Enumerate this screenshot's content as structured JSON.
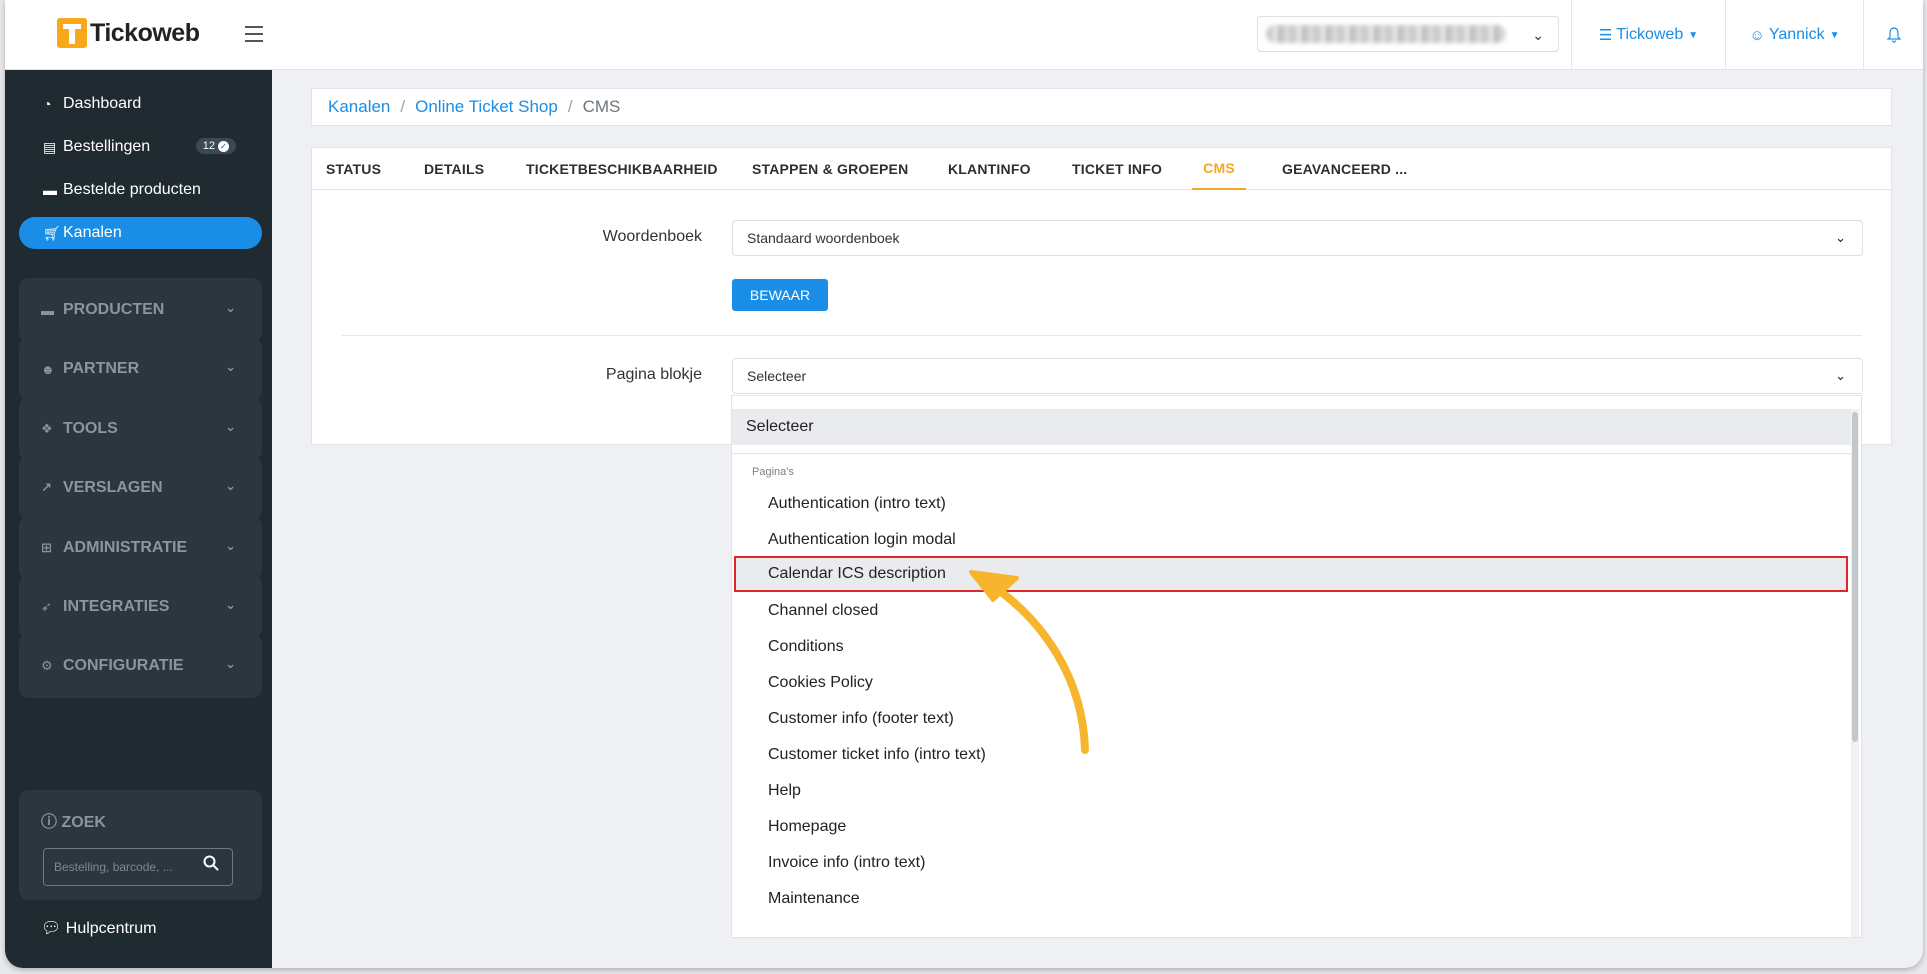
{
  "brand": {
    "name": "Tickoweb",
    "accent_color": "#1a8ee6",
    "logo_color": "#f7a81b"
  },
  "topbar": {
    "org_select_chevron": "chevron-down-icon",
    "org_menu": {
      "label": "Tickoweb",
      "icon": "sliders-icon"
    },
    "user_menu": {
      "label": "Yannick",
      "icon": "user-icon"
    },
    "notifications_icon": "bell-icon"
  },
  "sidebar": {
    "links": [
      {
        "label": "Dashboard",
        "icon": "dashboard-icon"
      },
      {
        "label": "Bestellingen",
        "icon": "file-icon",
        "badge": "12"
      },
      {
        "label": "Bestelde producten",
        "icon": "ticket-icon"
      },
      {
        "label": "Kanalen",
        "icon": "cart-icon",
        "active": true
      }
    ],
    "groups": [
      {
        "label": "PRODUCTEN",
        "icon": "ticket-icon"
      },
      {
        "label": "PARTNER",
        "icon": "user-icon"
      },
      {
        "label": "TOOLS",
        "icon": "puzzle-icon"
      },
      {
        "label": "VERSLAGEN",
        "icon": "chart-icon"
      },
      {
        "label": "ADMINISTRATIE",
        "icon": "table-icon"
      },
      {
        "label": "INTEGRATIES",
        "icon": "rocket-icon"
      },
      {
        "label": "CONFIGURATIE",
        "icon": "gear-icon"
      }
    ],
    "search": {
      "title": "ZOEK",
      "placeholder": "Bestelling, barcode, ..."
    },
    "help": {
      "label": "Hulpcentrum",
      "icon": "chat-icon"
    }
  },
  "breadcrumb": {
    "items": [
      "Kanalen",
      "Online Ticket Shop"
    ],
    "current": "CMS"
  },
  "tabs": [
    {
      "label": "STATUS"
    },
    {
      "label": "DETAILS"
    },
    {
      "label": "TICKETBESCHIKBAARHEID"
    },
    {
      "label": "STAPPEN & GROEPEN"
    },
    {
      "label": "KLANTINFO"
    },
    {
      "label": "TICKET INFO"
    },
    {
      "label": "CMS",
      "active": true
    },
    {
      "label": "GEAVANCEERD ..."
    }
  ],
  "form": {
    "dictionary_label": "Woordenboek",
    "dictionary_value": "Standaard woordenboek",
    "save_label": "BEWAAR",
    "page_block_label": "Pagina blokje",
    "page_block_value": "Selecteer"
  },
  "dropdown": {
    "selected_option": "Selecteer",
    "group_label": "Pagina's",
    "options": [
      "Authentication (intro text)",
      "Authentication login modal",
      "Calendar ICS description",
      "Channel closed",
      "Conditions",
      "Cookies Policy",
      "Customer info (footer text)",
      "Customer ticket info (intro text)",
      "Help",
      "Homepage",
      "Invoice info (intro text)",
      "Maintenance"
    ],
    "highlighted_index": 2,
    "highlight_color": "#e0262a",
    "annotation_arrow_color": "#f6b52c"
  }
}
